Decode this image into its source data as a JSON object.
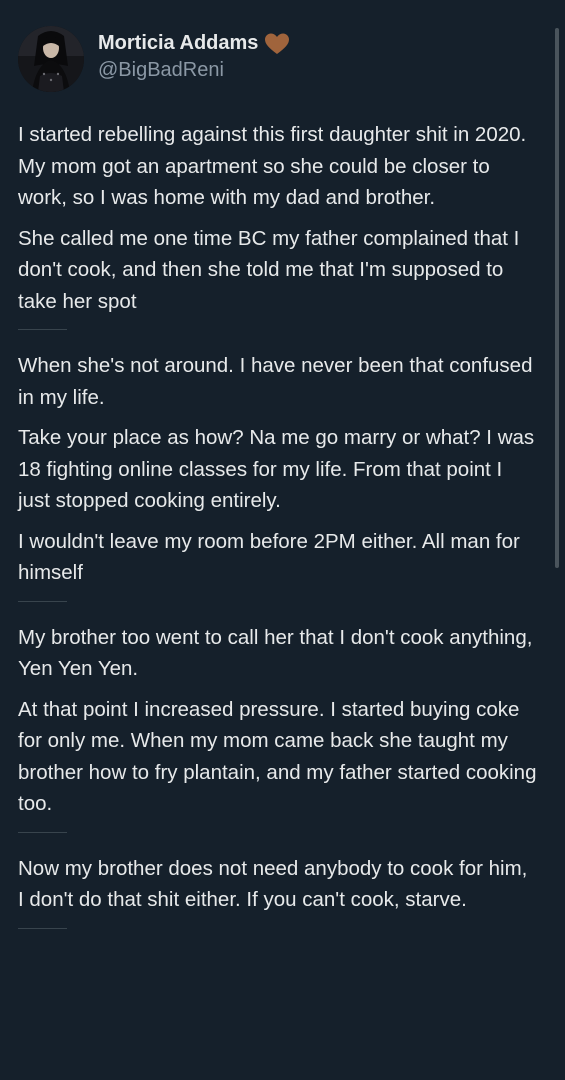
{
  "author": {
    "display_name": "Morticia Addams",
    "handle": "@BigBadReni",
    "badge_icon": "brown-heart-icon",
    "badge_color": "#a0643c"
  },
  "thread": {
    "sections": [
      {
        "paragraphs": [
          "I started rebelling against this first daughter shit in 2020. My mom got an apartment so she could be closer to work, so I was home with my dad and brother.",
          "She called me one time BC my father complained that I don't cook, and then she told me that I'm supposed to take her spot"
        ]
      },
      {
        "paragraphs": [
          "When she's not around. I have never been that confused in my life.",
          "Take your place as how? Na me go marry or what? I was 18 fighting online classes for my life. From that point I just stopped cooking entirely.",
          "I wouldn't leave my room before 2PM either. All man for himself"
        ]
      },
      {
        "paragraphs": [
          "My brother too went to call her that I don't cook anything, Yen Yen Yen.",
          "At that point I increased pressure. I started buying coke for only me. When my mom came back she taught my brother how to fry plantain, and my father started cooking too."
        ]
      },
      {
        "paragraphs": [
          "Now my brother does not need anybody to cook for him, I don't do that shit either. If you can't cook, starve."
        ]
      }
    ]
  },
  "colors": {
    "background": "#15202b",
    "text": "#e7e9ea",
    "secondary_text": "#8b98a5",
    "separator": "#38444d"
  }
}
